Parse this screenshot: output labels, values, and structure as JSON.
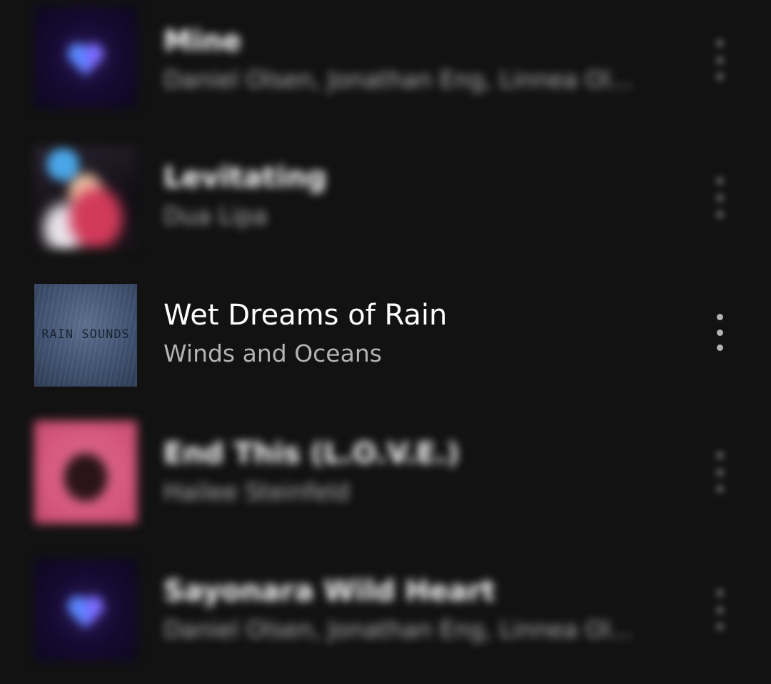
{
  "tracks": [
    {
      "title": "Mine",
      "artist": "Daniel Olsen, Jonathan Eng, Linnea Ol...",
      "artwork": "heart-artwork",
      "blurred": true
    },
    {
      "title": "Levitating",
      "artist": "Dua Lipa",
      "artwork": "levitating-artwork",
      "blurred": true
    },
    {
      "title": "Wet Dreams of Rain",
      "artist": "Winds and Oceans",
      "artwork": "rain-sounds-artwork",
      "artwork_label": "RAIN SOUNDS",
      "blurred": false
    },
    {
      "title": "End This (L.O.V.E.)",
      "artist": "Hailee Steinfeld",
      "artwork": "end-this-artwork",
      "blurred": true
    },
    {
      "title": "Sayonara Wild Heart",
      "artist": "Daniel Olsen, Jonathan Eng, Linnea Ol...",
      "artwork": "heart-artwork",
      "blurred": true
    }
  ],
  "icons": {
    "more_options": "more-vertical-icon"
  },
  "colors": {
    "background": "#121212",
    "title": "#ffffff",
    "subtitle": "#b3b3b3"
  }
}
